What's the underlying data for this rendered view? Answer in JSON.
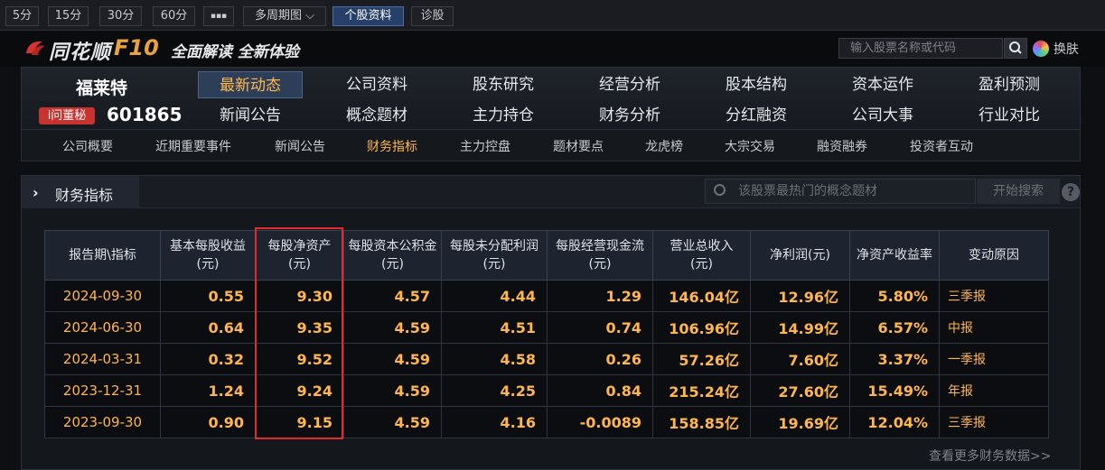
{
  "toolbar": {
    "buttons": [
      {
        "label": "5分"
      },
      {
        "label": "15分"
      },
      {
        "label": "30分"
      },
      {
        "label": "60分"
      },
      {
        "label": "▪▪▪"
      },
      {
        "label": "多周期图 ⌵"
      },
      {
        "label": "个股资料"
      },
      {
        "label": "诊股"
      }
    ]
  },
  "header": {
    "logo_text": "同花顺",
    "logo_f10": "F10",
    "slogan": "全面解读 全新体验",
    "search_placeholder": "输入股票名称或代码",
    "skin_label": "换肤"
  },
  "stock": {
    "name": "福莱特",
    "ask_badge": "i问董秘",
    "code": "601865"
  },
  "nav": {
    "row1": [
      "最新动态",
      "公司资料",
      "股东研究",
      "经营分析",
      "股本结构",
      "资本运作",
      "盈利预测"
    ],
    "row2": [
      "新闻公告",
      "概念题材",
      "主力持仓",
      "财务分析",
      "分红融资",
      "公司大事",
      "行业对比"
    ],
    "active": "最新动态"
  },
  "subnav": {
    "items": [
      "公司概要",
      "近期重要事件",
      "新闻公告",
      "财务指标",
      "主力控盘",
      "题材要点",
      "龙虎榜",
      "大宗交易",
      "融资融券",
      "投资者互动"
    ],
    "active": "财务指标"
  },
  "section": {
    "title": "财务指标",
    "concept_search_placeholder": "该股票最热门的概念题材",
    "concept_search_button": "开始搜索",
    "help": "?",
    "more_link": "查看更多财务数据>>"
  },
  "table": {
    "headers": [
      [
        "报告期\\指标",
        ""
      ],
      [
        "基本每股收益",
        "(元)"
      ],
      [
        "每股净资产",
        "(元)"
      ],
      [
        "每股资本公积金",
        "(元)"
      ],
      [
        "每股未分配利润",
        "(元)"
      ],
      [
        "每股经营现金流",
        "(元)"
      ],
      [
        "营业总收入",
        "(元)"
      ],
      [
        "净利润(元)",
        ""
      ],
      [
        "净资产收益率",
        ""
      ],
      [
        "变动原因",
        ""
      ]
    ],
    "rows": [
      [
        "2024-09-30",
        "0.55",
        "9.30",
        "4.57",
        "4.44",
        "1.29",
        "146.04亿",
        "12.96亿",
        "5.80%",
        "三季报"
      ],
      [
        "2024-06-30",
        "0.64",
        "9.35",
        "4.59",
        "4.51",
        "0.74",
        "106.96亿",
        "14.99亿",
        "6.57%",
        "中报"
      ],
      [
        "2024-03-31",
        "0.32",
        "9.52",
        "4.59",
        "4.58",
        "0.26",
        "57.26亿",
        "7.60亿",
        "3.37%",
        "一季报"
      ],
      [
        "2023-12-31",
        "1.24",
        "9.24",
        "4.59",
        "4.25",
        "0.84",
        "215.24亿",
        "27.60亿",
        "15.49%",
        "年报"
      ],
      [
        "2023-09-30",
        "0.90",
        "9.15",
        "4.59",
        "4.16",
        "-0.0089",
        "158.85亿",
        "19.69亿",
        "12.04%",
        "三季报"
      ]
    ]
  },
  "colors": {
    "accent_orange": "#ffb64a",
    "highlight_red": "#e02c2c",
    "badge_red": "#c8322f"
  }
}
